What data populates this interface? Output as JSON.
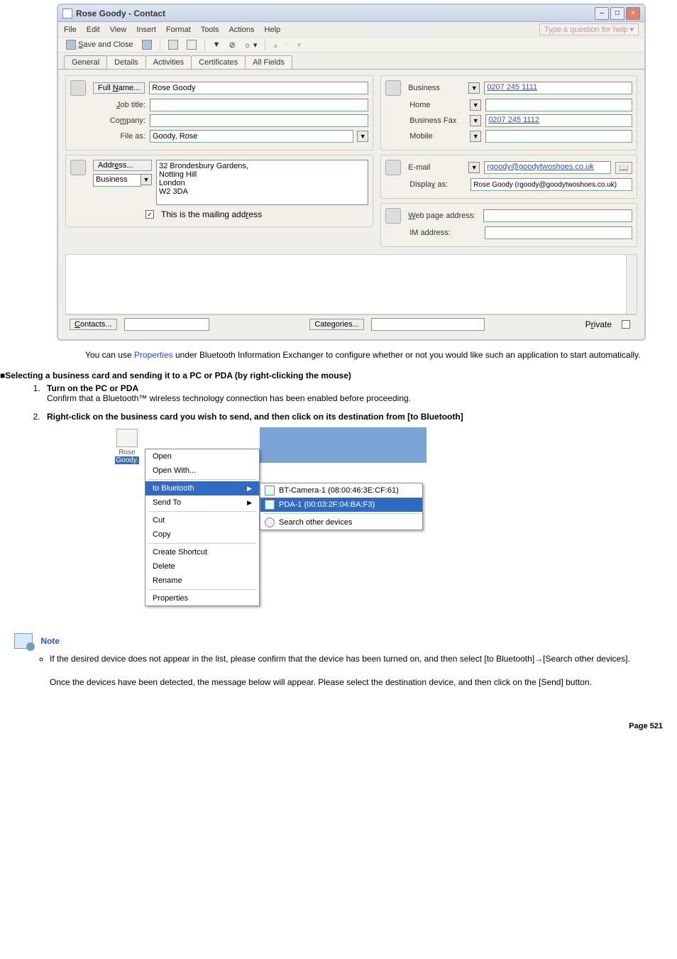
{
  "contact_window": {
    "title": "Rose Goody - Contact",
    "menubar": {
      "items": [
        "File",
        "Edit",
        "View",
        "Insert",
        "Format",
        "Tools",
        "Actions",
        "Help"
      ],
      "help_prompt": "Type a question for help"
    },
    "toolbar": {
      "save_close": "Save and Close"
    },
    "tabs": [
      "General",
      "Details",
      "Activities",
      "Certificates",
      "All Fields"
    ],
    "labels": {
      "full_name": "Full Name...",
      "job_title": "Job title:",
      "company": "Company:",
      "file_as": "File as:",
      "business": "Business",
      "home": "Home",
      "business_fax": "Business Fax",
      "mobile": "Mobile",
      "address": "Address...",
      "addr_type": "Business",
      "mailing_chk": "This is the mailing address",
      "email": "E-mail",
      "display_as": "Display as:",
      "web": "Web page address:",
      "im": "IM address:"
    },
    "values": {
      "full_name": "Rose Goody",
      "file_as": "Goody, Rose",
      "business": "0207 245 1111",
      "business_fax": "0207 245 1112",
      "address": "32  Brondesbury Gardens,\nNotting Hill\nLondon\nW2 3DA",
      "email": "rgoody@goodytwoshoes.co.uk",
      "display_as": "Rose Goody (rgoody@goodytwoshoes.co.uk)"
    },
    "footer": {
      "contacts": "Contacts...",
      "categories": "Categories...",
      "private": "Private"
    }
  },
  "body_text": {
    "p1a": "You can use ",
    "p1link": "Properties",
    "p1b": " under Bluetooth Information Exchanger to configure whether or not you would like such an application to start automatically.",
    "section": "Selecting a business card and sending it to a PC or PDA (by right-clicking the mouse)",
    "step1_t": "Turn on the PC or PDA",
    "step1_b": "Confirm that a Bluetooth™ wireless technology connection has been enabled before proceeding.",
    "step2_t": "Right-click on the business card you wish to send, and then click on its destination from [to Bluetooth]"
  },
  "ctx": {
    "icon_label_a": "Rose",
    "icon_label_b": "Goody.",
    "menu": [
      "Open",
      "Open With...",
      "to Bluetooth",
      "Send To",
      "Cut",
      "Copy",
      "Create Shortcut",
      "Delete",
      "Rename",
      "Properties"
    ],
    "submenu": {
      "a": "BT-Camera-1 (08:00:46:3E:CF:61)",
      "b": "PDA-1 (00:03:2F:04:BA:F3)",
      "c": "Search other devices"
    }
  },
  "note": {
    "label": "Note",
    "b1": "If the desired device does not appear in the list, please confirm that the device has been turned on, and then select [to Bluetooth]→[Search other devices].",
    "b2": "Once the devices have been detected, the message below will appear. Please select the destination device, and then click on the [Send] button."
  },
  "page_number": "Page  521"
}
